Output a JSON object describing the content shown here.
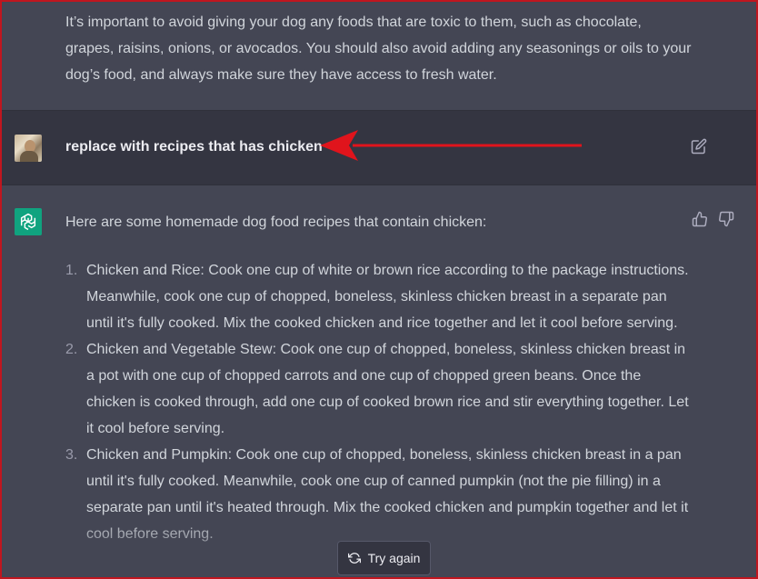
{
  "previous_response": {
    "text": "It’s important to avoid giving your dog any foods that are toxic to them, such as chocolate, grapes, raisins, onions, or avocados. You should also avoid adding any seasonings or oils to your dog’s food, and always make sure they have access to fresh water."
  },
  "user_message": {
    "text": "replace with recipes that has chicken",
    "edit_icon": "edit-icon"
  },
  "assistant_response": {
    "intro": "Here are some homemade dog food recipes that contain chicken:",
    "items": [
      {
        "number": "1.",
        "text": "Chicken and Rice: Cook one cup of white or brown rice according to the package instructions. Meanwhile, cook one cup of chopped, boneless, skinless chicken breast in a separate pan until it's fully cooked. Mix the cooked chicken and rice together and let it cool before serving."
      },
      {
        "number": "2.",
        "text": "Chicken and Vegetable Stew: Cook one cup of chopped, boneless, skinless chicken breast in a pot with one cup of chopped carrots and one cup of chopped green beans. Once the chicken is cooked through, add one cup of cooked brown rice and stir everything together. Let it cool before serving."
      },
      {
        "number": "3.",
        "text": "Chicken and Pumpkin: Cook one cup of chopped, boneless, skinless chicken breast in a pan until it's fully cooked. Meanwhile, cook one cup of canned pumpkin (not the pie filling) in a separate pan until it's heated through. Mix the cooked chicken and pumpkin together and let it cool before serving."
      }
    ]
  },
  "actions": {
    "try_again_label": "Try again"
  },
  "colors": {
    "accent": "#10a37f",
    "annotation_arrow": "#e0141c",
    "assistant_bg": "#444654",
    "user_bg": "#343541"
  }
}
